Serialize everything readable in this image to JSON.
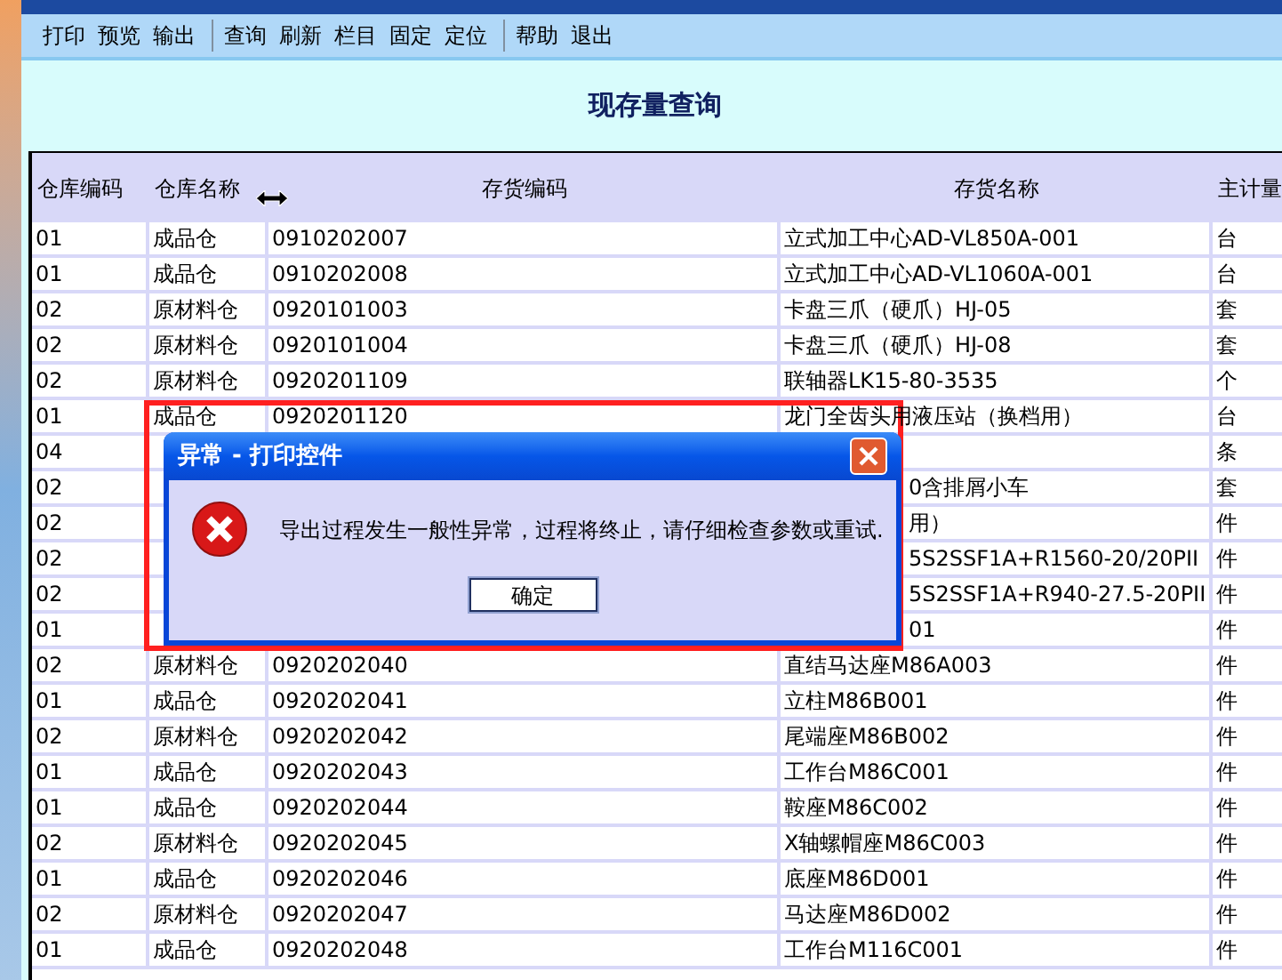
{
  "toolbar": {
    "groups": [
      [
        "打印",
        "预览",
        "输出"
      ],
      [
        "查询",
        "刷新",
        "栏目",
        "固定",
        "定位"
      ],
      [
        "帮助",
        "退出"
      ]
    ]
  },
  "title": "现存量查询",
  "table": {
    "columns": [
      "仓库编码",
      "仓库名称",
      "存货编码",
      "存货名称",
      "主计量"
    ],
    "rows": [
      {
        "cells": [
          "01",
          "成品仓",
          "0910202007",
          "立式加工中心AD-VL850A-001",
          "台"
        ]
      },
      {
        "cells": [
          "01",
          "成品仓",
          "0910202008",
          "立式加工中心AD-VL1060A-001",
          "台"
        ]
      },
      {
        "cells": [
          "02",
          "原材料仓",
          "0920101003",
          "卡盘三爪（硬爪）HJ-05",
          "套"
        ]
      },
      {
        "cells": [
          "02",
          "原材料仓",
          "0920101004",
          "卡盘三爪（硬爪）HJ-08",
          "套"
        ]
      },
      {
        "cells": [
          "02",
          "原材料仓",
          "0920201109",
          "联轴器LK15-80-3535",
          "个"
        ]
      },
      {
        "cells": [
          "01",
          "成品仓",
          "0920201120",
          "龙门全齿头用液压站（换档用）",
          "台"
        ]
      },
      {
        "cells": [
          "04",
          "",
          "",
          "",
          "条"
        ]
      },
      {
        "cells": [
          "02",
          "",
          "",
          "0含排屑小车",
          "套"
        ],
        "covered": true
      },
      {
        "cells": [
          "02",
          "",
          "",
          "用）",
          "件"
        ],
        "covered": true
      },
      {
        "cells": [
          "02",
          "",
          "",
          "5S2SSF1A+R1560-20/20PII",
          "件"
        ],
        "covered": true
      },
      {
        "cells": [
          "02",
          "",
          "",
          "5S2SSF1A+R940-27.5-20PII",
          "件"
        ],
        "covered": true
      },
      {
        "cells": [
          "01",
          "",
          "",
          "01",
          "件"
        ],
        "covered": true
      },
      {
        "cells": [
          "02",
          "原材料仓",
          "0920202040",
          "直结马达座M86A003",
          "件"
        ]
      },
      {
        "cells": [
          "01",
          "成品仓",
          "0920202041",
          "立柱M86B001",
          "件"
        ]
      },
      {
        "cells": [
          "02",
          "原材料仓",
          "0920202042",
          "尾端座M86B002",
          "件"
        ]
      },
      {
        "cells": [
          "01",
          "成品仓",
          "0920202043",
          "工作台M86C001",
          "件"
        ]
      },
      {
        "cells": [
          "01",
          "成品仓",
          "0920202044",
          "鞍座M86C002",
          "件"
        ]
      },
      {
        "cells": [
          "02",
          "原材料仓",
          "0920202045",
          "X轴螺帽座M86C003",
          "件"
        ]
      },
      {
        "cells": [
          "01",
          "成品仓",
          "0920202046",
          "底座M86D001",
          "件"
        ]
      },
      {
        "cells": [
          "02",
          "原材料仓",
          "0920202047",
          "马达座M86D002",
          "件"
        ]
      },
      {
        "cells": [
          "01",
          "成品仓",
          "0920202048",
          "工作台M116C001",
          "件"
        ]
      }
    ]
  },
  "dialog": {
    "title": "异常 - 打印控件",
    "message": "导出过程发生一般性异常，过程将终止，请仔细检查参数或重试.",
    "button": "确定"
  }
}
